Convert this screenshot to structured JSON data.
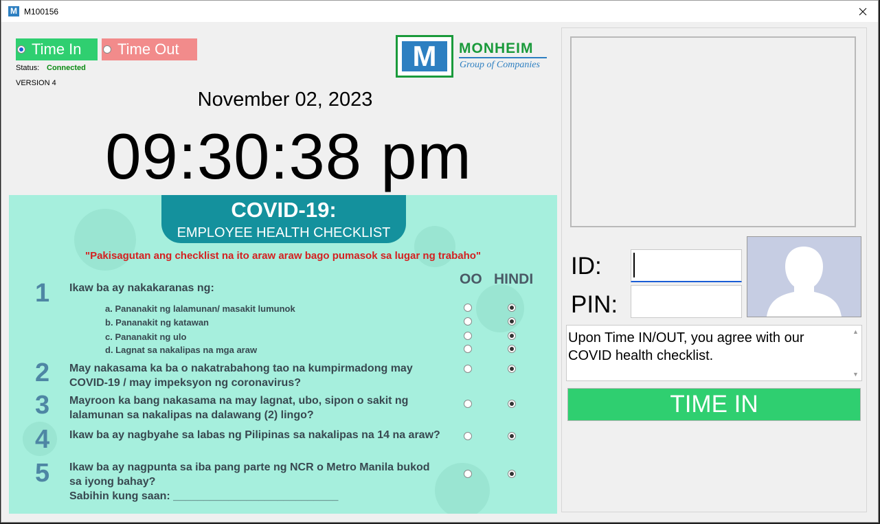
{
  "window": {
    "title": "M100156",
    "app_icon_letter": "M",
    "close_symbol": "✕"
  },
  "mode": {
    "time_in_label": "Time In",
    "time_out_label": "Time Out",
    "selected": "Time In"
  },
  "status": {
    "label": "Status:",
    "value": "Connected"
  },
  "version": "VERSION 4",
  "logo": {
    "letter": "M",
    "name": "MONHEIM",
    "tagline": "Group of Companies"
  },
  "clock": {
    "date": "November 02, 2023",
    "time": "09:30:38 pm"
  },
  "poster": {
    "title": "COVID-19:",
    "subtitle": "EMPLOYEE HEALTH CHECKLIST",
    "instruction": "\"Pakisagutan ang checklist na ito araw araw bago pumasok sa lugar ng trabaho\"",
    "col_yes": "OO",
    "col_no": "HINDI",
    "q1": {
      "num": "1",
      "text": "Ikaw ba ay nakakaranas ng:"
    },
    "q1_items": [
      "a. Pananakit ng lalamunan/ masakit lumunok",
      "b. Pananakit ng katawan",
      "c. Pananakit ng ulo",
      "d. Lagnat sa nakalipas na mga araw"
    ],
    "q2": {
      "num": "2",
      "text": "May nakasama ka ba o nakatrabahong tao na kumpirmadong may COVID-19 / may impeksyon ng coronavirus?"
    },
    "q3": {
      "num": "3",
      "text": "Mayroon ka bang nakasama na may lagnat, ubo, sipon o sakit ng lalamunan sa nakalipas na dalawang (2) lingo?"
    },
    "q4": {
      "num": "4",
      "text": "Ikaw ba ay nagbyahe sa labas ng Pilipinas sa nakalipas na 14 na araw?"
    },
    "q5": {
      "num": "5",
      "text": "Ikaw ba ay nagpunta sa iba pang parte ng NCR o Metro Manila bukod sa iyong bahay?"
    },
    "q5_extra": "Sabihin kung saan: ___________________________"
  },
  "form": {
    "id_label": "ID:",
    "pin_label": "PIN:",
    "id_value": "",
    "pin_value": ""
  },
  "notice": "Upon Time IN/OUT, you agree with our COVID health checklist.",
  "action_button": "TIME IN",
  "colors": {
    "time_in": "#2fcf70",
    "time_out": "#f28b8b",
    "connected": "#0a8a12",
    "accent": "#2d7fc1"
  }
}
